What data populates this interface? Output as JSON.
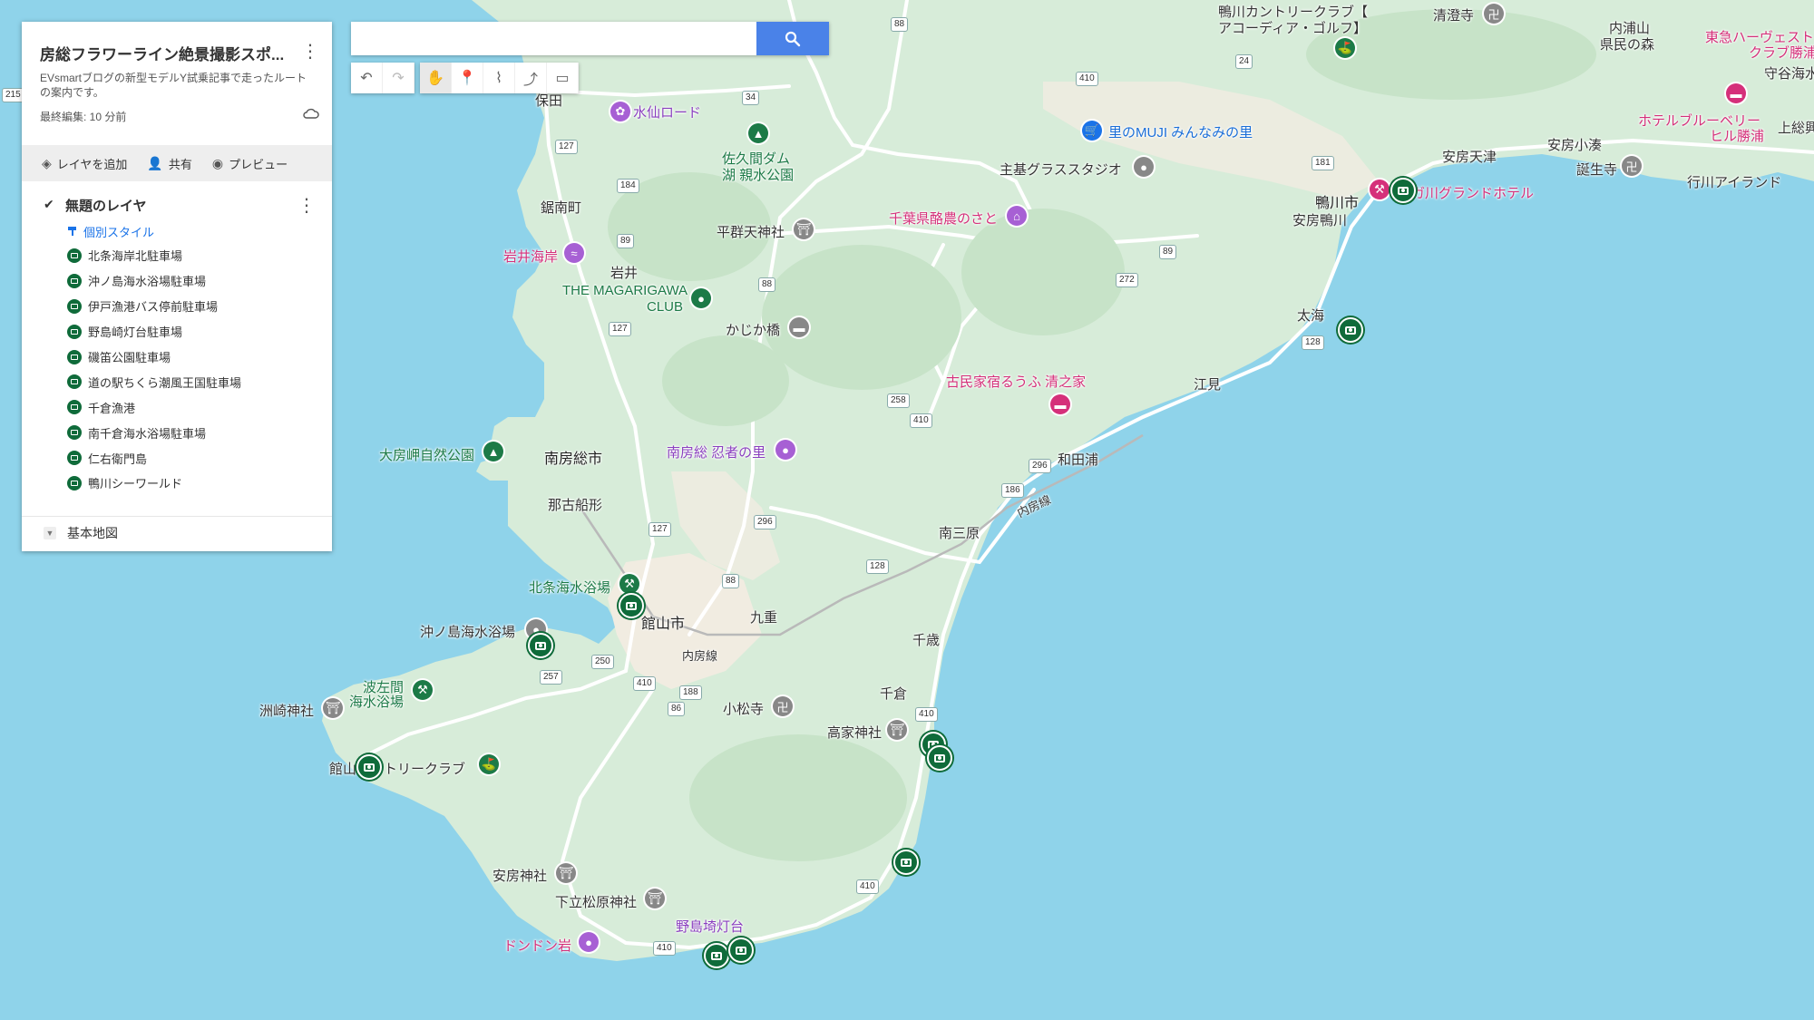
{
  "panel": {
    "title": "房総フラワーライン絶景撮影スポ...",
    "description": "EVsmartブログの新型モデルY試乗記事で走ったルートの案内です。",
    "last_edit": "最終編集: 10 分前",
    "actions": {
      "add_layer": "レイヤを追加",
      "share": "共有",
      "preview": "プレビュー"
    },
    "layer": {
      "name": "無題のレイヤ",
      "style": "個別スタイル",
      "features": [
        "北条海岸北駐車場",
        "沖ノ島海水浴場駐車場",
        "伊戸漁港バス停前駐車場",
        "野島崎灯台駐車場",
        "磯笛公園駐車場",
        "道の駅ちくら潮風王国駐車場",
        "千倉漁港",
        "南千倉海水浴場駐車場",
        "仁右衛門島",
        "鴨川シーワールド"
      ]
    },
    "basemap": "基本地図"
  },
  "search": {
    "placeholder": "",
    "value": ""
  },
  "map": {
    "labels": {
      "hota": "保田",
      "suisen": "水仙ロード",
      "sakuma": "佐久間ダム",
      "sakuma2": "湖 親水公園",
      "kyonan": "鋸南町",
      "heiguri": "平群天神社",
      "iwai_beach": "岩井海岸",
      "iwai": "岩井",
      "magarigawa1": "THE MAGARIGAWA",
      "magarigawa2": "CLUB",
      "kajika": "かじか橋",
      "muji": "里のMUJI みんなみの里",
      "shukigrass": "主基グラススタジオ",
      "rakuno": "千葉県酪農のさと",
      "kamogawa_cc1": "鴨川カントリークラブ【",
      "kamogawa_cc2": "アコーディア・ゴルフ】",
      "seichoji": "清澄寺",
      "uchiura1": "内浦山",
      "uchiura2": "県民の森",
      "tokyu1": "東急ハーヴェスト",
      "tokyu2": "クラブ勝浦",
      "moriya": "守谷海水",
      "hotelblue1": "ホテルブルーベリー",
      "hotelblue2": "ヒル勝浦",
      "kamiyu": "上総興",
      "awaamatsu": "安房天津",
      "awakominato": "安房小湊",
      "tanjoji": "誕生寺",
      "gyokawa": "行川アイランド",
      "kamogawa_city": "鴨川市",
      "awakamogawa": "安房鴨川",
      "grandhotel": "ガ川グランドホテル",
      "futomi": "太海",
      "emi": "江見",
      "kominka": "古民家宿るうふ 清之家",
      "minamiboso": "南房総市",
      "ninja": "南房総 忍者の里",
      "wadaura": "和田浦",
      "obusa": "大房岬自然公園",
      "nako": "那古船形",
      "minamihara": "南三原",
      "uchibo": "内房線",
      "hojo_beach": "北条海水浴場",
      "tateyama": "館山市",
      "kokonoe": "九重",
      "okinoshima": "沖ノ島海水浴場",
      "chitose": "千歳",
      "hasama1": "波左間",
      "hasama2": "海水浴場",
      "suzaki": "洲崎神社",
      "komatsu": "小松寺",
      "chikura": "千倉",
      "takabe": "高家神社",
      "tateyama_cc": "館山カントリークラブ",
      "awa_shrine": "安房神社",
      "shimotate": "下立松原神社",
      "nojima": "野島埼灯台",
      "dondon": "ドンドン岩",
      "uchibo2": "内房線"
    },
    "routes": [
      "215",
      "88",
      "24",
      "410",
      "34",
      "127",
      "184",
      "181",
      "89",
      "88",
      "272",
      "89",
      "127",
      "258",
      "410",
      "296",
      "186",
      "128",
      "127",
      "296",
      "88",
      "128",
      "250",
      "257",
      "410",
      "188",
      "86",
      "410",
      "410",
      "410"
    ]
  },
  "colors": {
    "water": "#8fd3ea",
    "land": "#d7ecd9",
    "urban": "#f1ece1",
    "pin_green": "#0f6b3a",
    "accent_blue": "#4a82e8"
  }
}
